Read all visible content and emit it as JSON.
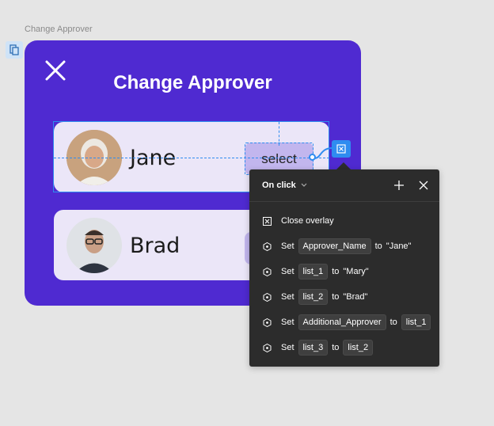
{
  "frame": {
    "label": "Change Approver"
  },
  "card": {
    "title": "Change Approver",
    "rows": [
      {
        "name": "Jane",
        "button": "select"
      },
      {
        "name": "Brad"
      }
    ]
  },
  "colors": {
    "card": "#4f2ad1",
    "row": "#ebe6f8",
    "select": "#c2b6ee",
    "selection": "#2f8cf0",
    "panel": "#2c2c2c"
  },
  "interaction_panel": {
    "trigger": "On click",
    "actions": [
      {
        "icon": "close-overlay-icon",
        "verb": "Close overlay"
      },
      {
        "icon": "variable-icon",
        "verb": "Set",
        "var": "Approver_Name",
        "to": "to",
        "value": "\"Jane\""
      },
      {
        "icon": "variable-icon",
        "verb": "Set",
        "var": "list_1",
        "to": "to",
        "value": "\"Mary\""
      },
      {
        "icon": "variable-icon",
        "verb": "Set",
        "var": "list_2",
        "to": "to",
        "value": "\"Brad\""
      },
      {
        "icon": "variable-icon",
        "verb": "Set",
        "var": "Additional_Approver",
        "to": "to",
        "chip_value": "list_1"
      },
      {
        "icon": "variable-icon",
        "verb": "Set",
        "var": "list_3",
        "to": "to",
        "chip_value": "list_2"
      }
    ]
  }
}
